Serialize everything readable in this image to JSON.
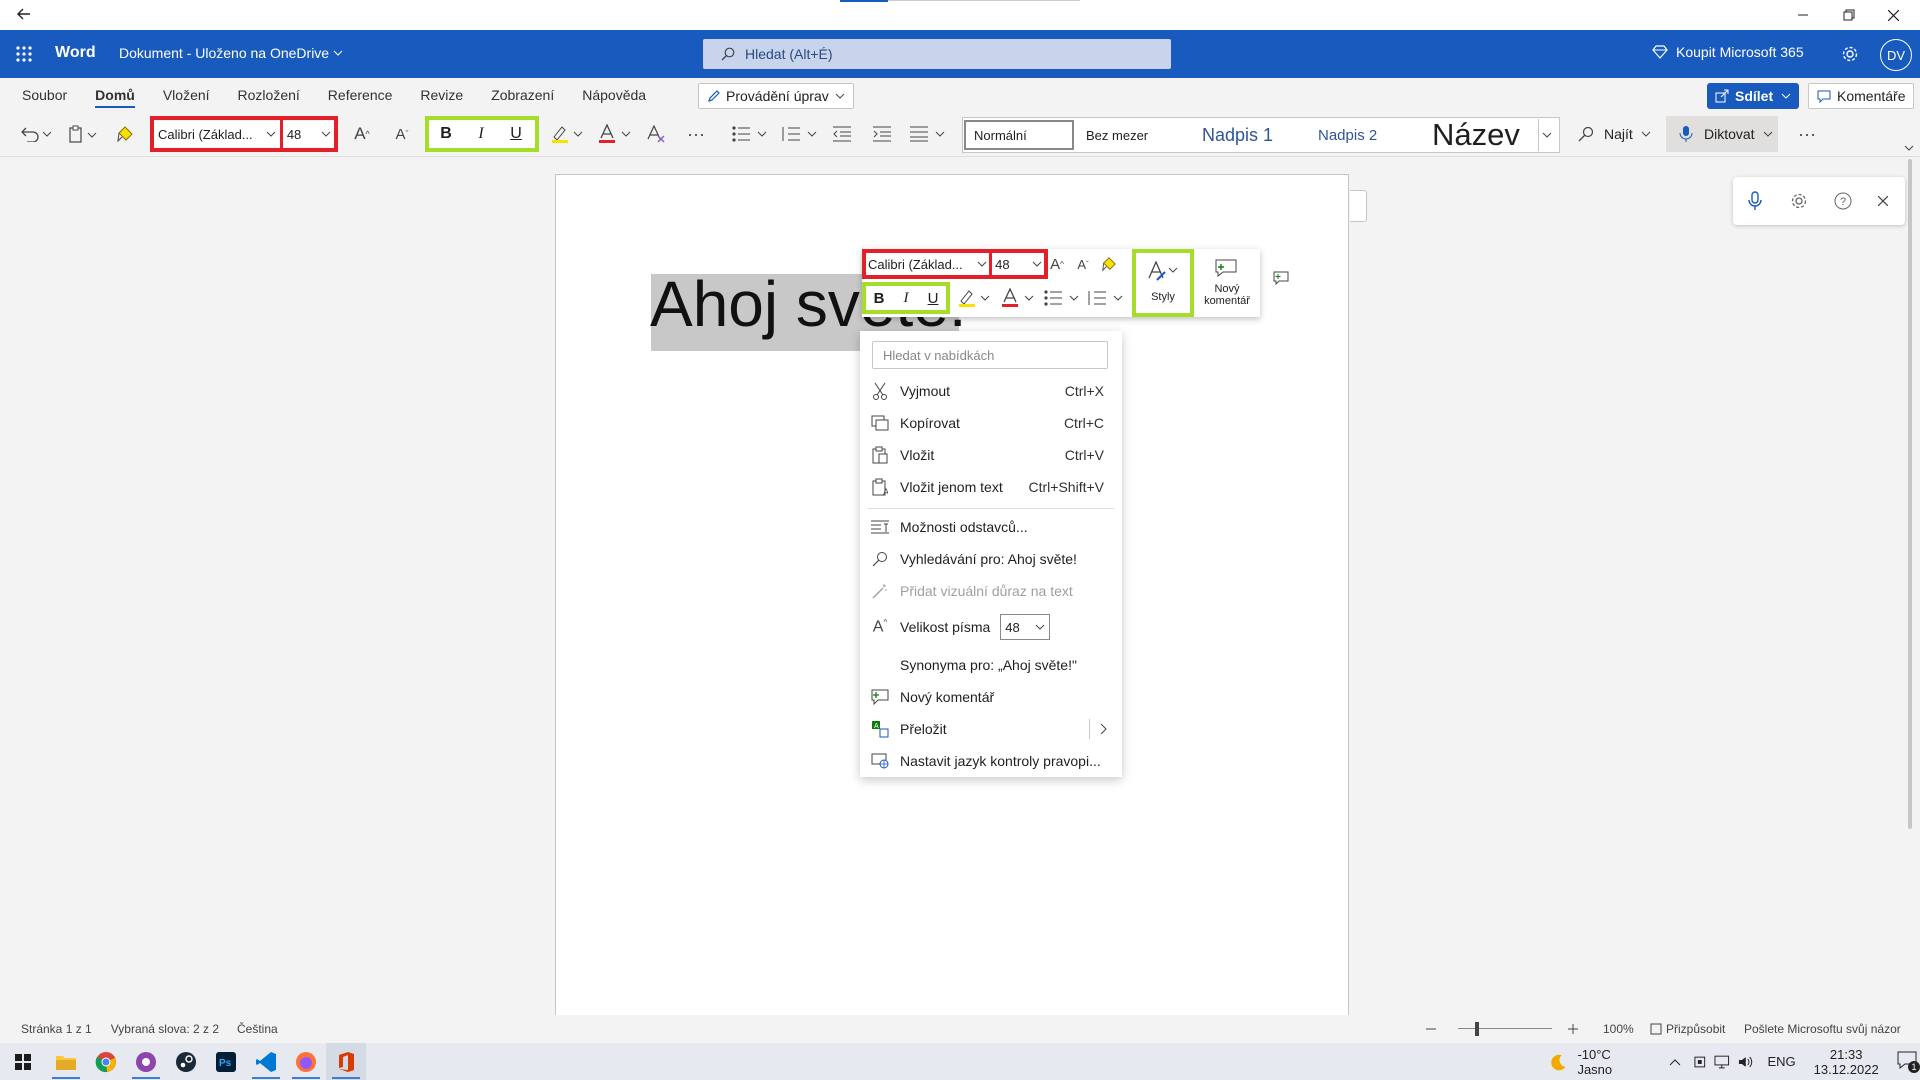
{
  "title_bar": {
    "app_name": "Word",
    "doc_title": "Dokument - Uloženo na OneDrive",
    "search_placeholder": "Hledat (Alt+É)",
    "buy": "Koupit Microsoft 365",
    "avatar": "DV"
  },
  "tabs": [
    "Soubor",
    "Domů",
    "Vložení",
    "Rozložení",
    "Reference",
    "Revize",
    "Zobrazení",
    "Nápověda"
  ],
  "editing_mode": "Provádění úprav",
  "share_label": "Sdílet",
  "comments_label": "Komentáře",
  "ribbon": {
    "font_name": "Calibri (Základ...",
    "font_size": "48",
    "styles": [
      "Normální",
      "Bez mezer",
      "Nadpis 1",
      "Nadpis 2",
      "Název"
    ],
    "find": "Najít",
    "dictate": "Diktovat"
  },
  "document": {
    "text": "Ahoj světe!"
  },
  "mini_toolbar": {
    "font_name": "Calibri (Základ...",
    "font_size": "48",
    "styles_label": "Styly",
    "comment_label_1": "Nový",
    "comment_label_2": "komentář"
  },
  "context_menu": {
    "search_placeholder": "Hledat v nabídkách",
    "items": [
      {
        "label": "Vyjmout",
        "shortcut": "Ctrl+X"
      },
      {
        "label": "Kopírovat",
        "shortcut": "Ctrl+C"
      },
      {
        "label": "Vložit",
        "shortcut": "Ctrl+V"
      },
      {
        "label": "Vložit jenom text",
        "shortcut": "Ctrl+Shift+V"
      },
      {
        "label": "Možnosti odstavců..."
      },
      {
        "label": "Vyhledávání pro: Ahoj světe!"
      },
      {
        "label": "Přidat vizuální důraz na text"
      },
      {
        "label": "Velikost písma",
        "value": "48"
      },
      {
        "label": "Synonyma pro: „Ahoj světe!\""
      },
      {
        "label": "Nový komentář"
      },
      {
        "label": "Přeložit"
      },
      {
        "label": "Nastavit jazyk kontroly pravopi..."
      }
    ]
  },
  "status": {
    "page": "Stránka 1 z 1",
    "words": "Vybraná slova: 2 z 2",
    "language": "Čeština",
    "zoom": "100%",
    "fit": "Přizpůsobit",
    "feedback": "Pošlete Microsoftu svůj názor"
  },
  "taskbar": {
    "weather": "-10°C Jasno",
    "lang": "ENG",
    "time": "21:33",
    "date": "13.12.2022",
    "notifications": "1"
  },
  "colors": {
    "brand": "#185abd",
    "highlight_red": "#e3202a",
    "highlight_green": "#a6dc2a"
  }
}
